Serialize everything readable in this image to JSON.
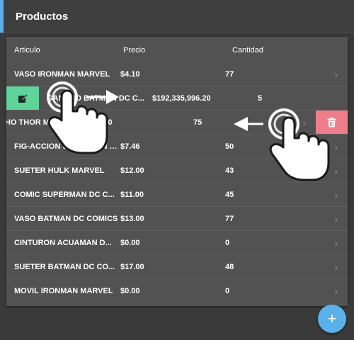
{
  "header": {
    "title": "Productos"
  },
  "table": {
    "columns": {
      "articulo": "Articulo",
      "precio": "Precio",
      "cantidad": "Cantidad"
    },
    "rows": [
      {
        "name": "VASO IRONMAN MARVEL",
        "price": "$4.10",
        "qty": "77"
      },
      {
        "name": "GANCHO BATMAN DC C...",
        "price": "$192,335,996.20",
        "qty": "5"
      },
      {
        "name": "HO THOR MARVEL",
        "price": "$17.00",
        "qty": "75"
      },
      {
        "name": "FIG-ACCION SUPERMAN M...",
        "price": "$7.46",
        "qty": "50"
      },
      {
        "name": "SUETER HULK MARVEL",
        "price": "$12.00",
        "qty": "43"
      },
      {
        "name": "COMIC SUPERMAN DC C...",
        "price": "$11.00",
        "qty": "45"
      },
      {
        "name": "VASO BATMAN DC COMICS",
        "price": "$13.00",
        "qty": "77"
      },
      {
        "name": "CINTURON ACUAMAN D...",
        "price": "$0.00",
        "qty": "0"
      },
      {
        "name": "SUETER BATMAN DC CO...",
        "price": "$17.00",
        "qty": "48"
      },
      {
        "name": "MOVIL IRONMAN MARVEL",
        "price": "$0.00",
        "qty": "0"
      }
    ]
  },
  "icons": {
    "row_chevron": "chevron-right-icon",
    "edit": "edit-icon",
    "delete": "trash-icon",
    "add": "plus-icon",
    "gesture": "swipe-hand-icon"
  },
  "colors": {
    "accent": "#5ab0e8",
    "edit": "#5fd39a",
    "delete": "#ef7d8b",
    "background": "#3a3a3a",
    "card": "#525252"
  },
  "fab": {
    "label": "+"
  }
}
